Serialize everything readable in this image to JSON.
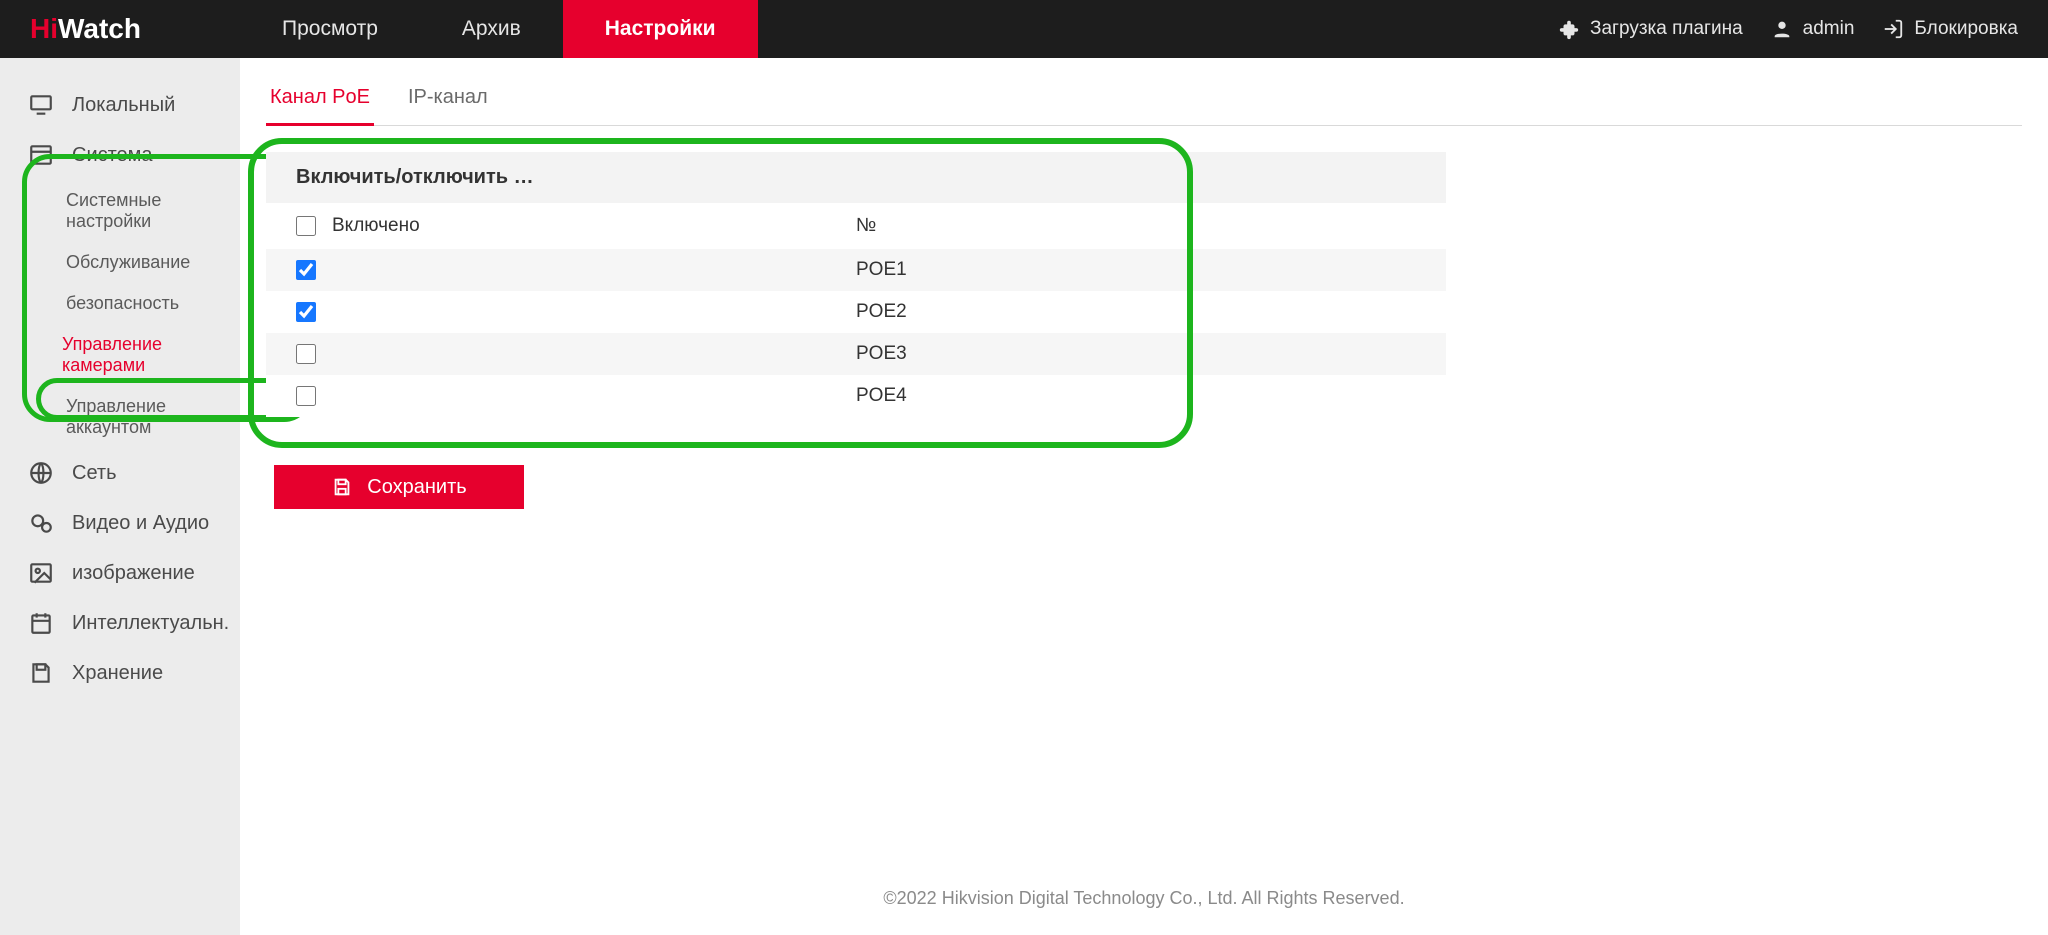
{
  "brand": {
    "part1": "Hi",
    "part2": "Watch"
  },
  "topnav": {
    "view": "Просмотр",
    "archive": "Архив",
    "settings": "Настройки"
  },
  "topright": {
    "plugin": "Загрузка плагина",
    "user": "admin",
    "lock": "Блокировка"
  },
  "sidebar": {
    "local": "Локальный",
    "system": "Система",
    "system_settings": "Системные настройки",
    "maintenance": "Обслуживание",
    "security": "безопасность",
    "cam_mgmt": "Управление камерами",
    "account_mgmt": "Управление аккаунтом",
    "network": "Сеть",
    "va": "Видео и Аудио",
    "image": "изображение",
    "smart": "Интеллектуальн.",
    "storage": "Хранение"
  },
  "tabs": {
    "poe": "Канал PoE",
    "ip": "IP-канал"
  },
  "table": {
    "title": "Включить/отключить …",
    "col_enabled": "Включено",
    "col_no": "№",
    "rows": [
      {
        "checked": true,
        "no": "POE1"
      },
      {
        "checked": true,
        "no": "POE2"
      },
      {
        "checked": false,
        "no": "POE3"
      },
      {
        "checked": false,
        "no": "POE4"
      }
    ]
  },
  "save": "Сохранить",
  "footer": "©2022 Hikvision Digital Technology Co., Ltd. All Rights Reserved."
}
